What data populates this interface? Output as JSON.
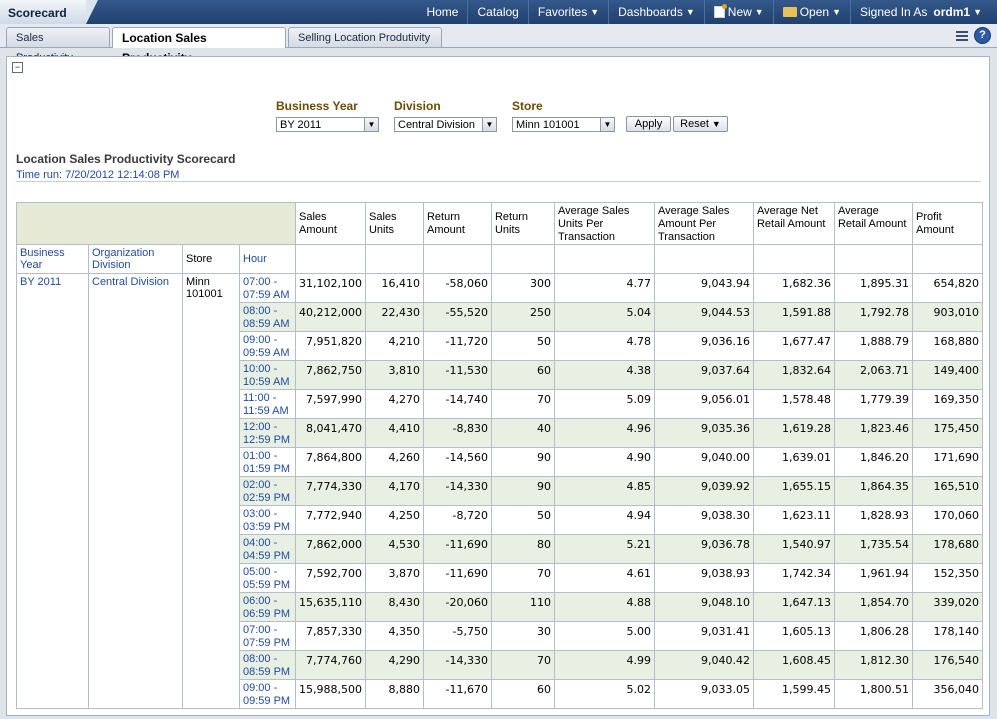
{
  "app": {
    "title": "Scorecard"
  },
  "topnav": {
    "home": "Home",
    "catalog": "Catalog",
    "favorites": "Favorites",
    "dashboards": "Dashboards",
    "new": "New",
    "open": "Open",
    "signed_in_as": "Signed In As",
    "user": "ordm1"
  },
  "tabs": [
    {
      "label": "Sales Productivity",
      "active": false
    },
    {
      "label": "Location Sales Productivity",
      "active": true
    },
    {
      "label": "Selling Location Produtivity",
      "active": false
    }
  ],
  "prompts": {
    "business_year": {
      "label": "Business Year",
      "value": "BY 2011"
    },
    "division": {
      "label": "Division",
      "value": "Central Division"
    },
    "store": {
      "label": "Store",
      "value": "Minn 101001"
    },
    "apply_label": "Apply",
    "reset_label": "Reset"
  },
  "report": {
    "title": "Location Sales Productivity Scorecard",
    "time_run": "Time run: 7/20/2012 12:14:08 PM"
  },
  "table": {
    "dim_headers": {
      "business_year": "Business Year",
      "org_division": "Organization Division",
      "store": "Store",
      "hour": "Hour"
    },
    "measure_headers": [
      "Sales Amount",
      "Sales Units",
      "Return Amount",
      "Return Units",
      "Average Sales Units Per Transaction",
      "Average Sales Amount Per Transaction",
      "Average Net Retail Amount",
      "Average Retail Amount",
      "Profit Amount"
    ],
    "dims": {
      "business_year": "BY 2011",
      "org_division": "Central Division",
      "store": "Minn 101001"
    },
    "rows": [
      {
        "hour": "07:00 - 07:59 AM",
        "v": [
          "31,102,100",
          "16,410",
          "-58,060",
          "300",
          "4.77",
          "9,043.94",
          "1,682.36",
          "1,895.31",
          "654,820"
        ]
      },
      {
        "hour": "08:00 - 08:59 AM",
        "v": [
          "40,212,000",
          "22,430",
          "-55,520",
          "250",
          "5.04",
          "9,044.53",
          "1,591.88",
          "1,792.78",
          "903,010"
        ]
      },
      {
        "hour": "09:00 - 09:59 AM",
        "v": [
          "7,951,820",
          "4,210",
          "-11,720",
          "50",
          "4.78",
          "9,036.16",
          "1,677.47",
          "1,888.79",
          "168,880"
        ]
      },
      {
        "hour": "10:00 - 10:59 AM",
        "v": [
          "7,862,750",
          "3,810",
          "-11,530",
          "60",
          "4.38",
          "9,037.64",
          "1,832.64",
          "2,063.71",
          "149,400"
        ]
      },
      {
        "hour": "11:00 - 11:59 AM",
        "v": [
          "7,597,990",
          "4,270",
          "-14,740",
          "70",
          "5.09",
          "9,056.01",
          "1,578.48",
          "1,779.39",
          "169,350"
        ]
      },
      {
        "hour": "12:00 - 12:59 PM",
        "v": [
          "8,041,470",
          "4,410",
          "-8,830",
          "40",
          "4.96",
          "9,035.36",
          "1,619.28",
          "1,823.46",
          "175,450"
        ]
      },
      {
        "hour": "01:00 - 01:59 PM",
        "v": [
          "7,864,800",
          "4,260",
          "-14,560",
          "90",
          "4.90",
          "9,040.00",
          "1,639.01",
          "1,846.20",
          "171,690"
        ]
      },
      {
        "hour": "02:00 - 02:59 PM",
        "v": [
          "7,774,330",
          "4,170",
          "-14,330",
          "90",
          "4.85",
          "9,039.92",
          "1,655.15",
          "1,864.35",
          "165,510"
        ]
      },
      {
        "hour": "03:00 - 03:59 PM",
        "v": [
          "7,772,940",
          "4,250",
          "-8,720",
          "50",
          "4.94",
          "9,038.30",
          "1,623.11",
          "1,828.93",
          "170,060"
        ]
      },
      {
        "hour": "04:00 - 04:59 PM",
        "v": [
          "7,862,000",
          "4,530",
          "-11,690",
          "80",
          "5.21",
          "9,036.78",
          "1,540.97",
          "1,735.54",
          "178,680"
        ]
      },
      {
        "hour": "05:00 - 05:59 PM",
        "v": [
          "7,592,700",
          "3,870",
          "-11,690",
          "70",
          "4.61",
          "9,038.93",
          "1,742.34",
          "1,961.94",
          "152,350"
        ]
      },
      {
        "hour": "06:00 - 06:59 PM",
        "v": [
          "15,635,110",
          "8,430",
          "-20,060",
          "110",
          "4.88",
          "9,048.10",
          "1,647.13",
          "1,854.70",
          "339,020"
        ]
      },
      {
        "hour": "07:00 - 07:59 PM",
        "v": [
          "7,857,330",
          "4,350",
          "-5,750",
          "30",
          "5.00",
          "9,031.41",
          "1,605.13",
          "1,806.28",
          "178,140"
        ]
      },
      {
        "hour": "08:00 - 08:59 PM",
        "v": [
          "7,774,760",
          "4,290",
          "-14,330",
          "70",
          "4.99",
          "9,040.42",
          "1,608.45",
          "1,812.30",
          "176,540"
        ]
      },
      {
        "hour": "09:00 - 09:59 PM",
        "v": [
          "15,988,500",
          "8,880",
          "-11,670",
          "60",
          "5.02",
          "9,033.05",
          "1,599.45",
          "1,800.51",
          "356,040"
        ]
      }
    ]
  }
}
